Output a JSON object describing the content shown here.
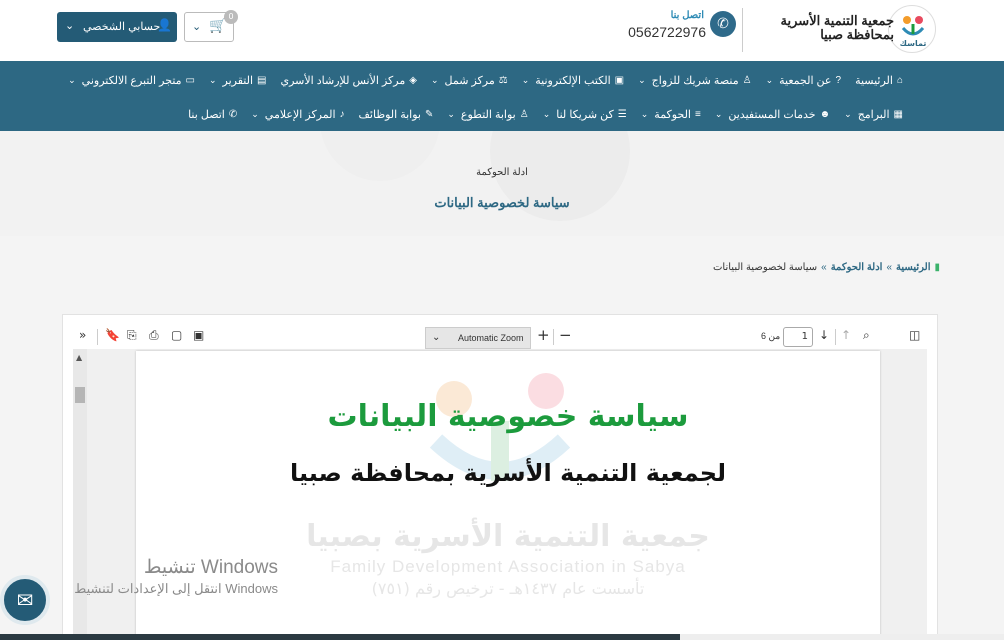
{
  "header": {
    "org_name_line1": "جمعية التنمية الأسرية",
    "org_name_line2": "بمحافظة صبيا",
    "logo_text": "تماسك",
    "contact_label": "اتصل بنا",
    "contact_phone": "0562722976",
    "account_label": "حسابي الشخصي",
    "cart_count": "0"
  },
  "nav": {
    "row1": [
      {
        "label": "الرئيسية",
        "icon": "home-icon",
        "glyph": "⌂",
        "dropdown": false
      },
      {
        "label": "عن الجمعية",
        "icon": "question-icon",
        "glyph": "?",
        "dropdown": true
      },
      {
        "label": "منصة شريك للزواج",
        "icon": "person-icon",
        "glyph": "♙",
        "dropdown": true
      },
      {
        "label": "الكتب الإلكترونية",
        "icon": "book-icon",
        "glyph": "▣",
        "dropdown": true
      },
      {
        "label": "مركز شمل",
        "icon": "scale-icon",
        "glyph": "⚖",
        "dropdown": true
      },
      {
        "label": "مركز الأنس للإرشاد الأسري",
        "icon": "handshake-icon",
        "glyph": "◈",
        "dropdown": false
      },
      {
        "label": "التقرير",
        "icon": "report-icon",
        "glyph": "▤",
        "dropdown": true
      },
      {
        "label": "متجر التبرع الالكتروني",
        "icon": "card-icon",
        "glyph": "▭",
        "dropdown": true
      }
    ],
    "row2": [
      {
        "label": "البرامج",
        "icon": "calendar-icon",
        "glyph": "▦",
        "dropdown": true
      },
      {
        "label": "خدمات المستفيدين",
        "icon": "users-icon",
        "glyph": "☻",
        "dropdown": true
      },
      {
        "label": "الحوكمة",
        "icon": "list-icon",
        "glyph": "≡",
        "dropdown": true
      },
      {
        "label": "كن شريكا لنا",
        "icon": "server-icon",
        "glyph": "☰",
        "dropdown": true
      },
      {
        "label": "بوابة التطوع",
        "icon": "person-icon",
        "glyph": "♙",
        "dropdown": true
      },
      {
        "label": "بوابة الوظائف",
        "icon": "edit-icon",
        "glyph": "✎",
        "dropdown": false
      },
      {
        "label": "المركز الإعلامي",
        "icon": "mic-icon",
        "glyph": "♪",
        "dropdown": true
      },
      {
        "label": "اتصل بنا",
        "icon": "phone-icon",
        "glyph": "✆",
        "dropdown": false
      }
    ]
  },
  "hero": {
    "small_title": "ادلة الحوكمة",
    "title": "سياسة لخصوصية البيانات"
  },
  "breadcrumb": {
    "home": "الرئيسية",
    "section": "ادلة الحوكمة",
    "current": "سياسة لخصوصية البيانات",
    "separator": "»"
  },
  "viewer": {
    "zoom": "Automatic Zoom",
    "page_current": "1",
    "page_of": "من 6",
    "doc_title": "سياسة خصوصية البيانات",
    "doc_subtitle": "لجمعية التنمية الأسرية بمحافظة صبيا",
    "watermark_ar": "جمعية التنمية الأسرية بصبيا",
    "watermark_en": "Family Development Association in Sabya",
    "watermark_est": "تأسست عام ١٤٣٧هـ - ترخيص رقم (٧٥١)"
  },
  "windows_activation": {
    "line1": "تنشيط Windows",
    "line2": "انتقل إلى الإعدادات لتنشيط Windows"
  },
  "colors": {
    "primary": "#2d6883",
    "dark": "#245b76",
    "accent_green": "#1c9b3d",
    "link_blue": "#2e8bb5"
  }
}
